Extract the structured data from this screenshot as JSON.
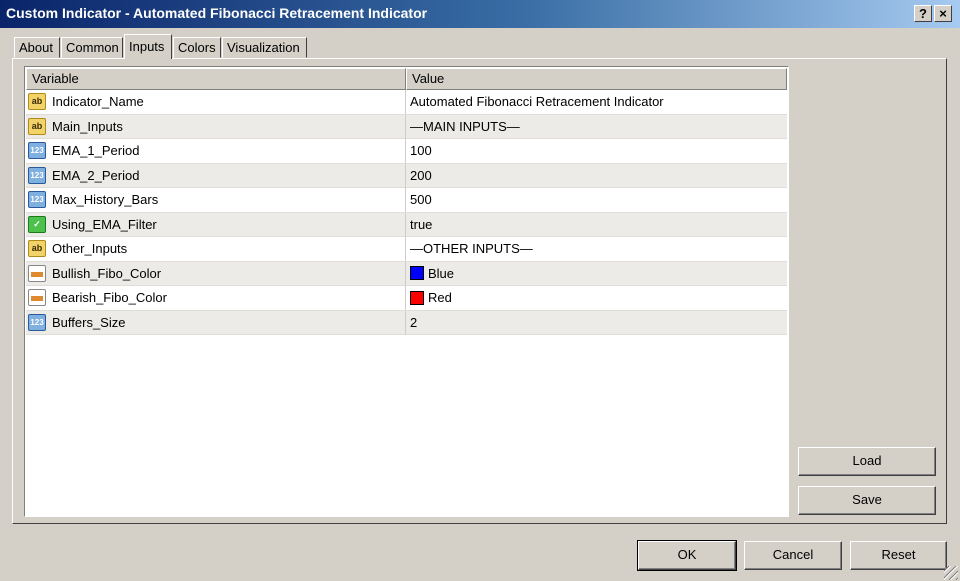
{
  "window": {
    "title": "Custom Indicator - Automated Fibonacci Retracement Indicator",
    "help_label": "?",
    "close_label": "×"
  },
  "tabs": [
    {
      "label": "About"
    },
    {
      "label": "Common"
    },
    {
      "label": "Inputs",
      "active": true
    },
    {
      "label": "Colors"
    },
    {
      "label": "Visualization"
    }
  ],
  "grid": {
    "headers": {
      "variable": "Variable",
      "value": "Value"
    },
    "rows": [
      {
        "icon": "ab",
        "name": "Indicator_Name",
        "value": "Automated Fibonacci Retracement Indicator"
      },
      {
        "icon": "ab",
        "name": "Main_Inputs",
        "value": "—MAIN INPUTS—"
      },
      {
        "icon": "123",
        "name": "EMA_1_Period",
        "value": "100"
      },
      {
        "icon": "123",
        "name": "EMA_2_Period",
        "value": "200"
      },
      {
        "icon": "123",
        "name": "Max_History_Bars",
        "value": "500"
      },
      {
        "icon": "bool",
        "name": "Using_EMA_Filter",
        "value": "true"
      },
      {
        "icon": "ab",
        "name": "Other_Inputs",
        "value": "—OTHER INPUTS—"
      },
      {
        "icon": "color",
        "name": "Bullish_Fibo_Color",
        "value": "Blue",
        "swatch": "#0000ff"
      },
      {
        "icon": "color",
        "name": "Bearish_Fibo_Color",
        "value": "Red",
        "swatch": "#ff0000"
      },
      {
        "icon": "123",
        "name": "Buffers_Size",
        "value": "2"
      }
    ]
  },
  "buttons": {
    "load": "Load",
    "save": "Save",
    "ok": "OK",
    "cancel": "Cancel",
    "reset": "Reset"
  },
  "icon_labels": {
    "ab": "ab",
    "num": "123"
  }
}
